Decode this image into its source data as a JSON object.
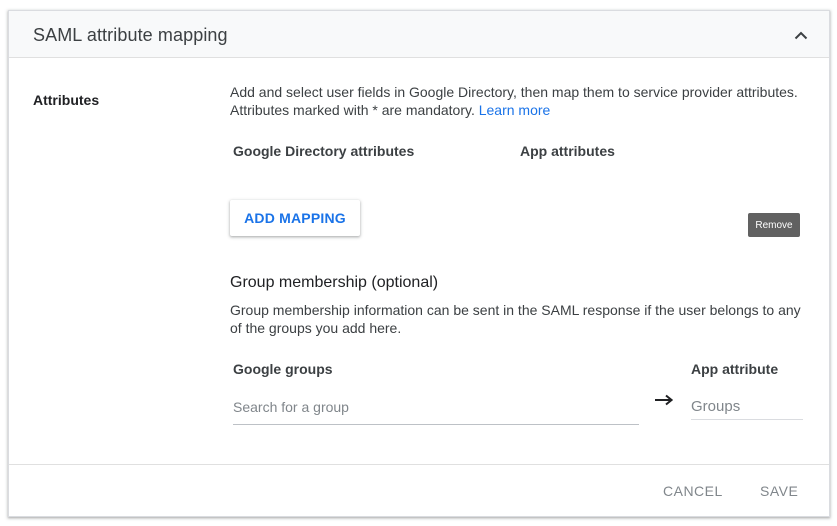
{
  "panel": {
    "title": "SAML attribute mapping",
    "collapse_icon": "chevron-up-icon"
  },
  "attributes": {
    "label": "Attributes",
    "description": "Add and select user fields in Google Directory, then map them to service provider attributes. Attributes marked with * are mandatory.",
    "learn_more": "Learn more",
    "col_directory": "Google Directory attributes",
    "col_app": "App attributes",
    "add_mapping_label": "ADD MAPPING",
    "remove_tooltip": "Remove"
  },
  "group_membership": {
    "title": "Group membership (optional)",
    "description": "Group membership information can be sent in the SAML response if the user belongs to any of the groups you add here.",
    "col_groups": "Google groups",
    "col_app_attribute": "App attribute",
    "search_placeholder": "Search for a group",
    "groups_placeholder": "Groups",
    "arrow_icon": "arrow-right-icon"
  },
  "footer": {
    "cancel": "CANCEL",
    "save": "SAVE"
  },
  "colors": {
    "accent": "#1a73e8",
    "header_bg": "#f8f9fa",
    "tooltip_bg": "#616161",
    "disabled_text": "#80868b"
  }
}
